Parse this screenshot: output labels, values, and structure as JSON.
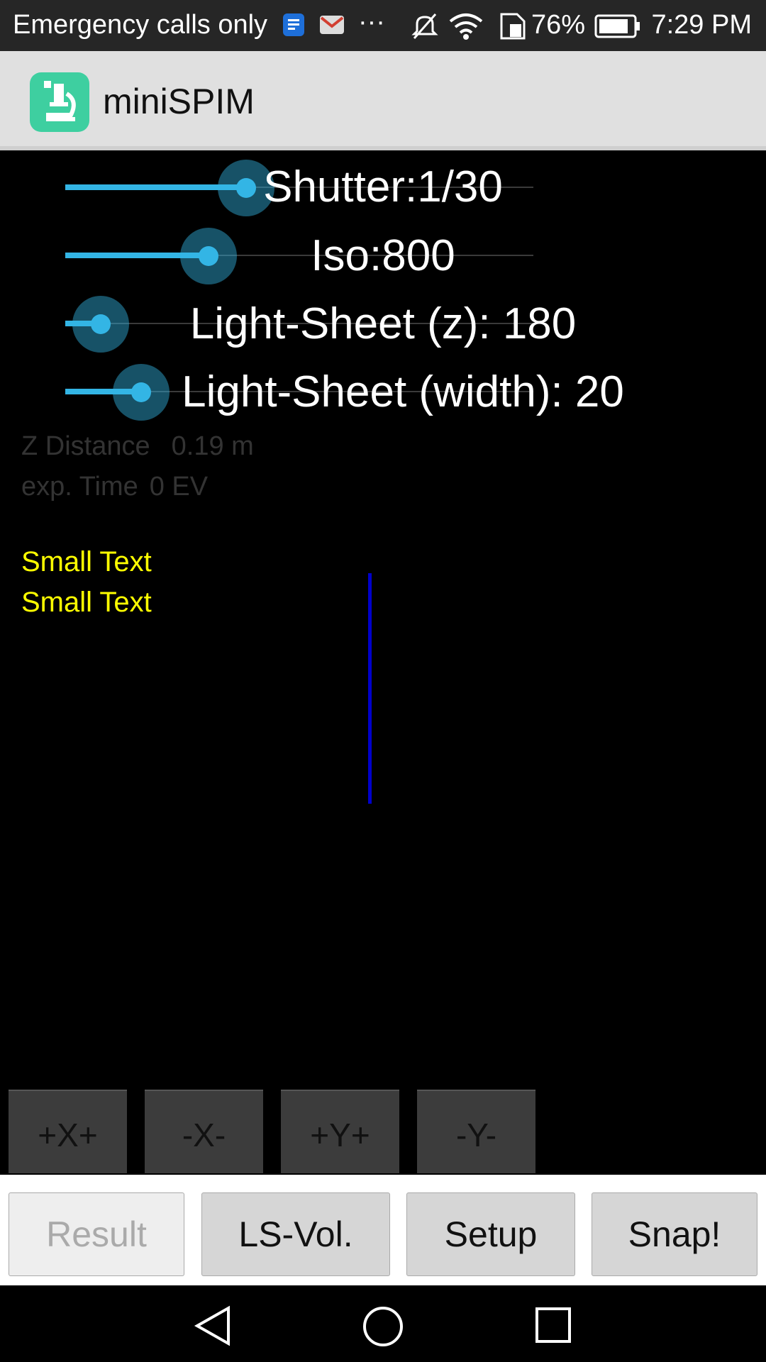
{
  "status_bar": {
    "carrier": "Emergency calls only",
    "battery": "76%",
    "time": "7:29 PM"
  },
  "app": {
    "title": "miniSPIM"
  },
  "sliders": [
    {
      "label": "Shutter:1/30",
      "level": 0.387
    },
    {
      "label": "Iso:800",
      "level": 0.306
    },
    {
      "label": "Light-Sheet (z): 180",
      "level": 0.076
    },
    {
      "label": "Light-Sheet (width): 20",
      "level": 0.162
    }
  ],
  "info": {
    "z_distance_label": "Z Distance",
    "z_distance_value": "0.19 m",
    "exp_time_label": "exp. Time",
    "exp_time_value": "0 EV"
  },
  "small_text": [
    "Small Text",
    "Small Text"
  ],
  "move_buttons": [
    "+X+",
    "-X-",
    "+Y+",
    "-Y-"
  ],
  "bottom_buttons": {
    "result": "Result",
    "ls_vol": "LS-Vol.",
    "setup": "Setup",
    "snap": "Snap!"
  }
}
